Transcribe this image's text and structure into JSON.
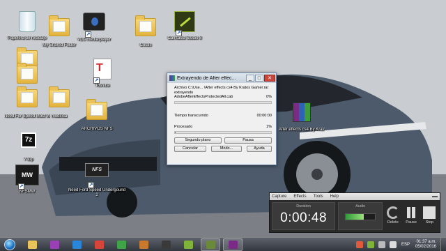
{
  "desktop_icons": [
    {
      "label": "Papelera de reciclaje",
      "icon": "recycle-bin-icon"
    },
    {
      "label": "My Shared Folder",
      "icon": "folder-icon"
    },
    {
      "label": "VLC media player",
      "icon": "vlc-icon"
    },
    {
      "label": "Cosas",
      "icon": "folder-icon"
    },
    {
      "label": "Camtasia Studio 8",
      "icon": "camtasia-icon"
    },
    {
      "label": "",
      "icon": "folder-icon"
    },
    {
      "label": "Toshiba",
      "icon": "toshiba-icon"
    },
    {
      "label": "Solucion",
      "icon": "folder-icon"
    },
    {
      "label": "Need For Speed Most Wanted",
      "icon": "folder-icon"
    },
    {
      "label": "modifica",
      "icon": "folder-icon"
    },
    {
      "label": "ARCHIVOS NFS",
      "icon": "folder-icon"
    },
    {
      "label": "After effects cs4 By Kratos Gamer",
      "icon": "winrar-archive-icon"
    },
    {
      "label": "7-Zip",
      "icon": "7zip-icon"
    },
    {
      "label": "NFSMW",
      "icon": "nfsmw-icon"
    },
    {
      "label": "Need Ford Speed Undergound 2",
      "icon": "nfs-underground-icon"
    }
  ],
  "dialog": {
    "title": "Extrayendo de After effec...",
    "min": "_",
    "max": "□",
    "close": "✕",
    "archive_line": "Archivo C:\\Use... \\After effects cs4 By Kratos Gamer.rar",
    "action": "extrayendo",
    "file": "AdobeAfterEffectsProtectedAll.cab",
    "file_percent": "0%",
    "file_progress": 0,
    "elapsed_label": "Tiempo transcurrido",
    "elapsed_value": "00:00:00",
    "processed_label": "Procesado",
    "processed_percent": "1%",
    "processed_progress": 0.01,
    "buttons": {
      "background": "Segundo plano",
      "pause": "Pausa",
      "cancel": "Cancelar",
      "mode": "Modo...",
      "help": "Ayuda"
    }
  },
  "recorder": {
    "menu": [
      "Capture",
      "Effects",
      "Tools",
      "Help"
    ],
    "duration_label": "Duration",
    "duration": "0:00:48",
    "audio_label": "Audio",
    "audio_level": 0.62,
    "delete_label": "Delete",
    "pause_label": "Pause",
    "stop_label": "Stop"
  },
  "taskbar": {
    "apps": [
      {
        "name": "file-explorer",
        "color": "#e8c35a",
        "active": false
      },
      {
        "name": "media",
        "color": "#9a3fb5",
        "active": false
      },
      {
        "name": "ie",
        "color": "#2a86d8",
        "active": false
      },
      {
        "name": "chrome",
        "color": "#d7453a",
        "active": false
      },
      {
        "name": "chrome2",
        "color": "#3fa347",
        "active": false
      },
      {
        "name": "game",
        "color": "#c9792d",
        "active": false
      },
      {
        "name": "terminal",
        "color": "#3a3a3a",
        "active": false
      },
      {
        "name": "camtasia",
        "color": "#7fb33a",
        "active": false
      },
      {
        "name": "recorder",
        "color": "#6a8a3a",
        "active": true
      },
      {
        "name": "winrar",
        "color": "#7a2b86",
        "active": true
      }
    ],
    "language": "ESP",
    "time": "01:37 a.m.",
    "date": "05/02/2016"
  }
}
